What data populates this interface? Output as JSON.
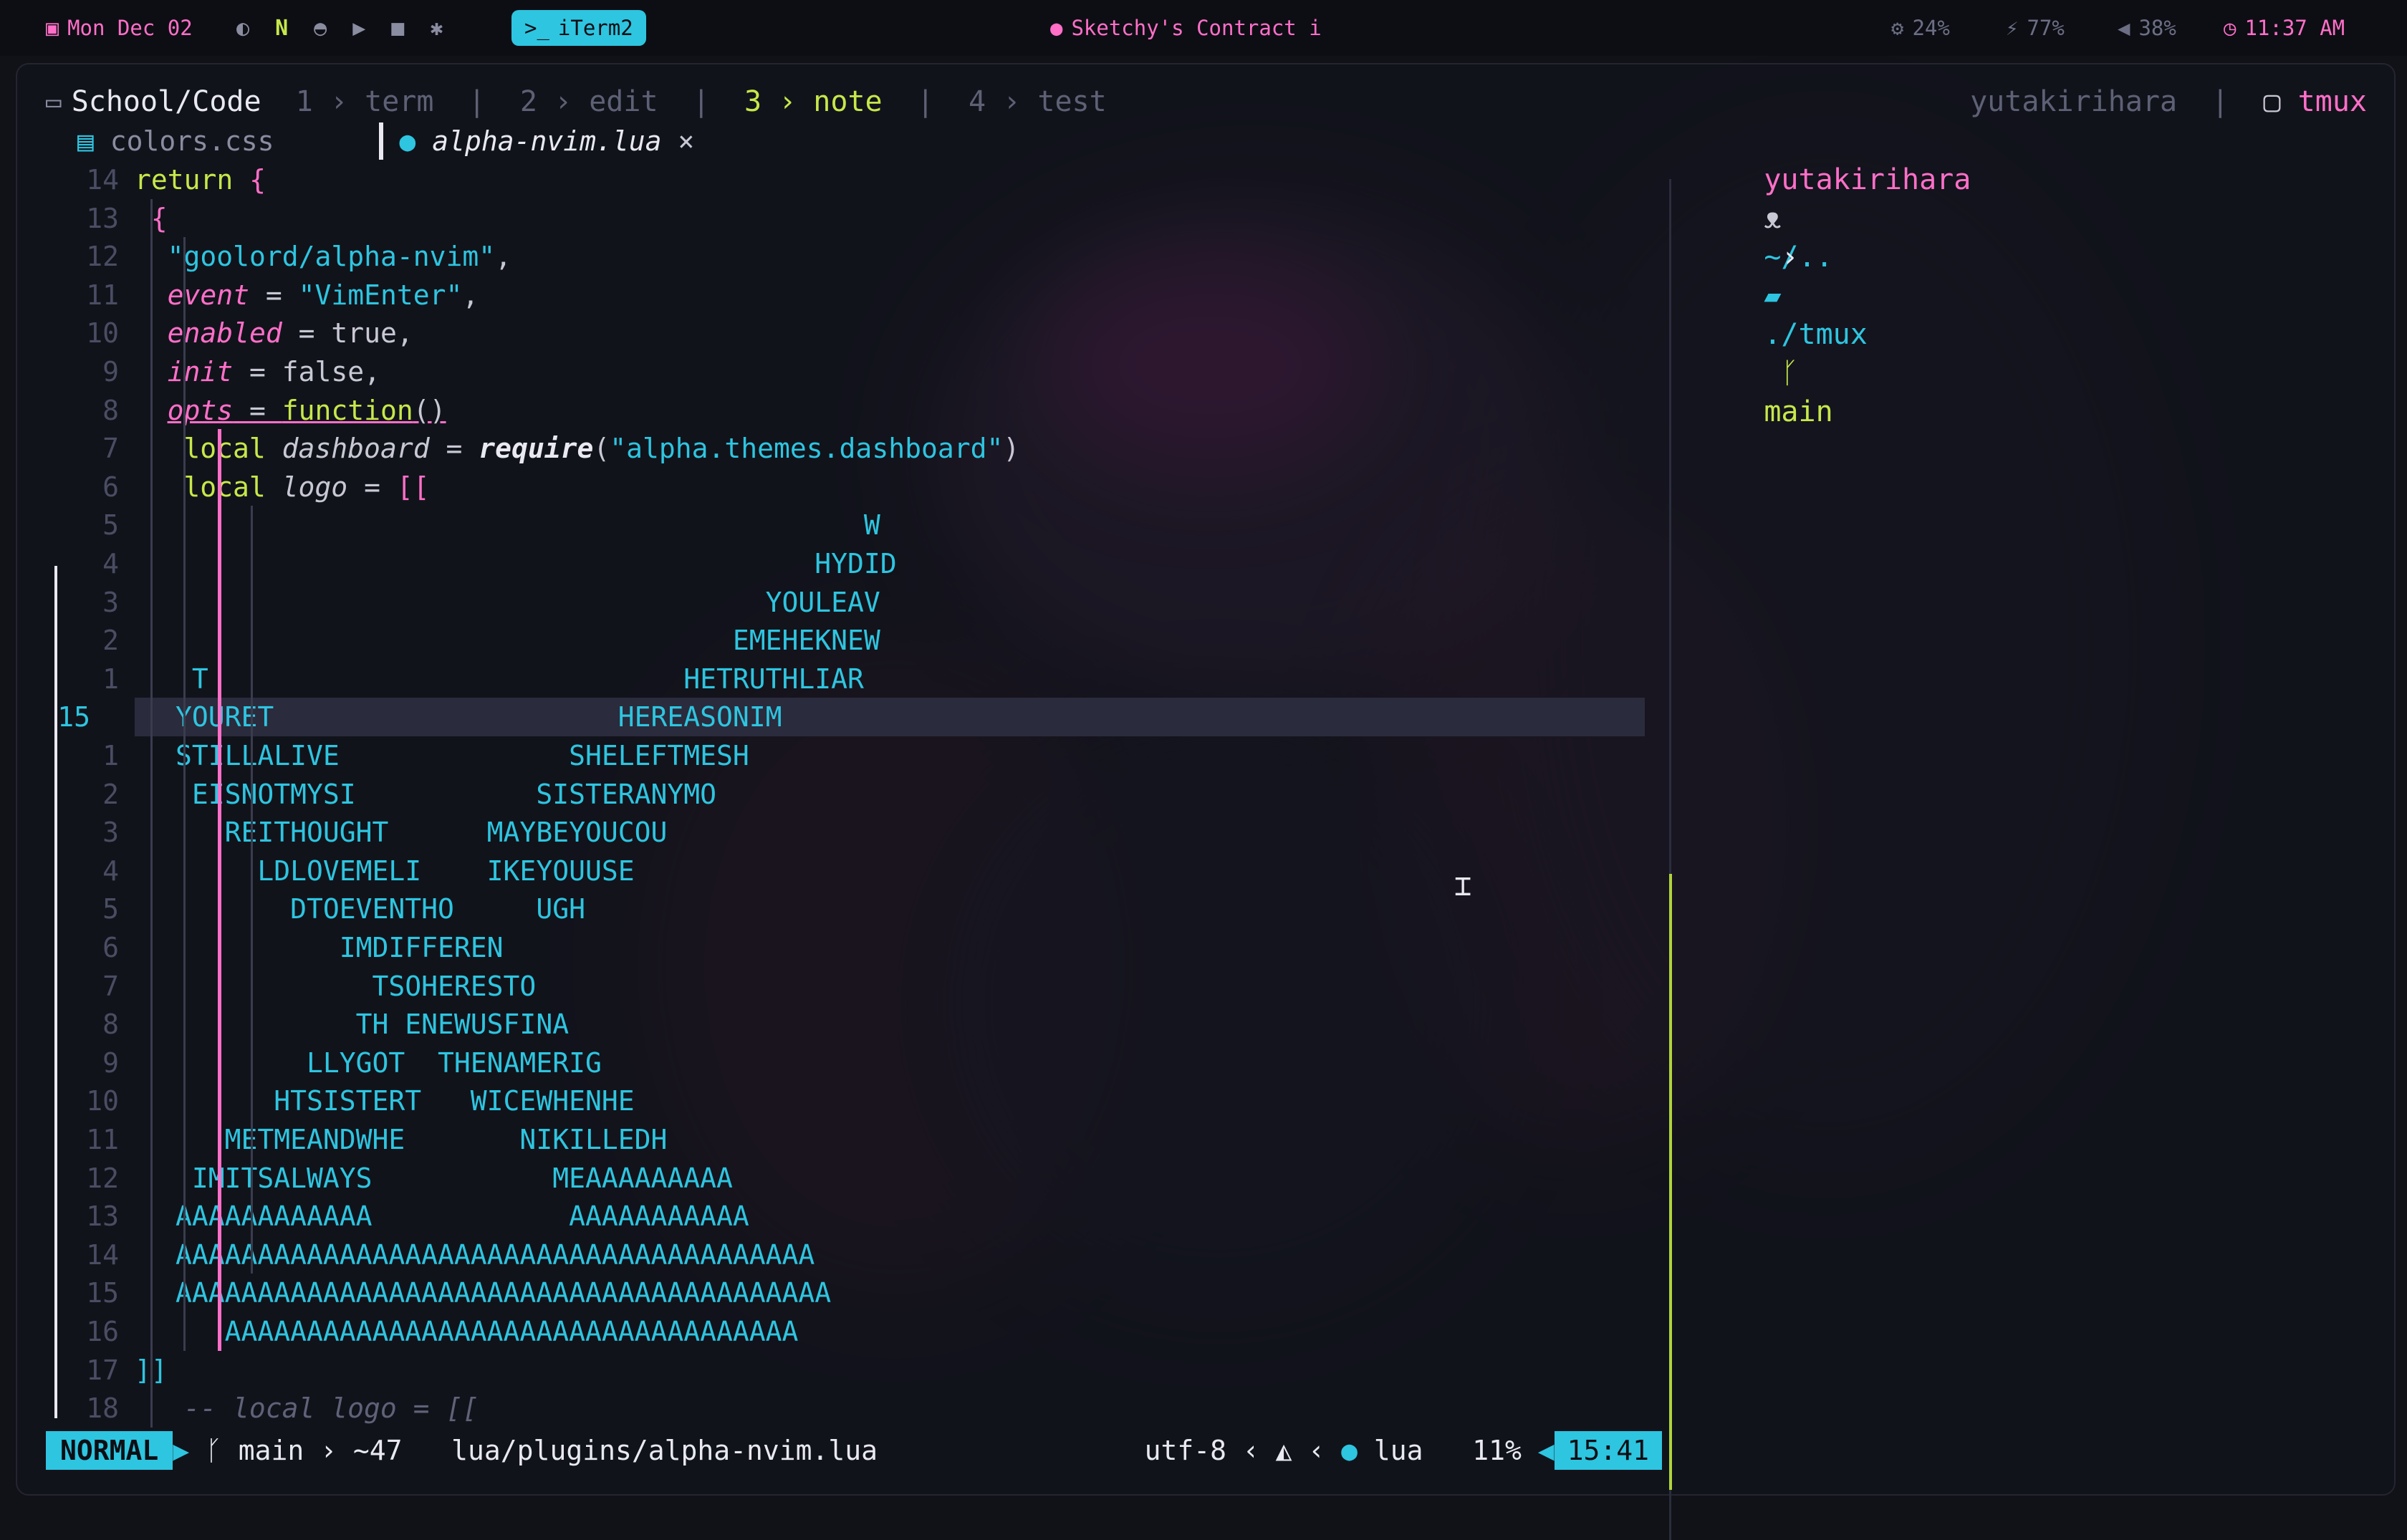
{
  "menubar": {
    "date": "Mon Dec 02",
    "active_app": "iTerm2",
    "now_playing": "Sketchy's Contract i",
    "cpu": "24%",
    "battery": "77%",
    "volume": "38%",
    "time": "11:37 AM"
  },
  "tmux": {
    "session": "School/Code",
    "windows": [
      {
        "index": "1",
        "name": "term"
      },
      {
        "index": "2",
        "name": "edit"
      },
      {
        "index": "3",
        "name": "note"
      },
      {
        "index": "4",
        "name": "test"
      }
    ],
    "active_window": "3",
    "user": "yutakirihara",
    "right_label": "tmux"
  },
  "editor": {
    "buffers": [
      {
        "name": "colors.css"
      },
      {
        "name": "alpha-nvim.lua",
        "active": true,
        "close": "×"
      }
    ],
    "code_lines": [
      {
        "n": "14",
        "text": "return {"
      },
      {
        "n": "13",
        "text": "{"
      },
      {
        "n": "12",
        "text": "\"goolord/alpha-nvim\","
      },
      {
        "n": "11",
        "text": "event = \"VimEnter\","
      },
      {
        "n": "10",
        "text": "enabled = true,"
      },
      {
        "n": "9",
        "text": "init = false,"
      },
      {
        "n": "8",
        "text": "opts = function()"
      },
      {
        "n": "7",
        "text": "local dashboard = require(\"alpha.themes.dashboard\")"
      },
      {
        "n": "6",
        "text": "local logo = [["
      }
    ],
    "art_lines": [
      {
        "n": "5",
        "text": "                                          W"
      },
      {
        "n": "4",
        "text": "                                       HYDID"
      },
      {
        "n": "3",
        "text": "                                    YOULEAV"
      },
      {
        "n": "2",
        "text": "                                  EMEHEKNEW"
      },
      {
        "n": "1",
        "text": " T                             HETRUTHLIAR"
      },
      {
        "n": "15",
        "text": "YOURET                     HEREASONIM",
        "cursor": true
      },
      {
        "n": "1",
        "text": "STILLALIVE              SHELEFTMESH"
      },
      {
        "n": "2",
        "text": " EISNOTMYSI           SISTERANYMO"
      },
      {
        "n": "3",
        "text": "   REITHOUGHT      MAYBEYOUCOU"
      },
      {
        "n": "4",
        "text": "     LDLOVEMELI    IKEYOUUSE"
      },
      {
        "n": "5",
        "text": "       DTOEVENTHO     UGH"
      },
      {
        "n": "6",
        "text": "          IMDIFFEREN"
      },
      {
        "n": "7",
        "text": "            TSOHERESTO"
      },
      {
        "n": "8",
        "text": "           TH ENEWUSFINA"
      },
      {
        "n": "9",
        "text": "        LLYGOT  THENAMERIG"
      },
      {
        "n": "10",
        "text": "      HTSISTERT   WICEWHENHE"
      },
      {
        "n": "11",
        "text": "   METMEANDWHE       NIKILLEDH"
      },
      {
        "n": "12",
        "text": " IMITSALWAYS           MEAAAAAAAAA"
      },
      {
        "n": "13",
        "text": "AAAAAAAAAAAA            AAAAAAAAAAA"
      },
      {
        "n": "14",
        "text": "AAAAAAAAAAAAAAAAAAAAAAAAAAAAAAAAAAAAAAA"
      },
      {
        "n": "15",
        "text": "AAAAAAAAAAAAAAAAAAAAAAAAAAAAAAAAAAAAAAAA"
      },
      {
        "n": "16",
        "text": "   AAAAAAAAAAAAAAAAAAAAAAAAAAAAAAAAAAA"
      }
    ],
    "close_line": {
      "n": "17",
      "text": "]]"
    },
    "comment_line": {
      "n": "18",
      "text": "-- local logo = [["
    }
  },
  "statusline": {
    "mode": "NORMAL",
    "branch": "main",
    "changes": "~47",
    "file": "lua/plugins/alpha-nvim.lua",
    "encoding": "utf-8",
    "filetype": "lua",
    "percent": "11%",
    "position": "15:41"
  },
  "shell": {
    "user": "yutakirihara",
    "path": "~/..",
    "path_tail": "./tmux",
    "branch": "main"
  },
  "colors": {
    "accent_cyan": "#2ec5e0",
    "accent_pink": "#ff6fc8",
    "accent_lime": "#c6e84a"
  }
}
